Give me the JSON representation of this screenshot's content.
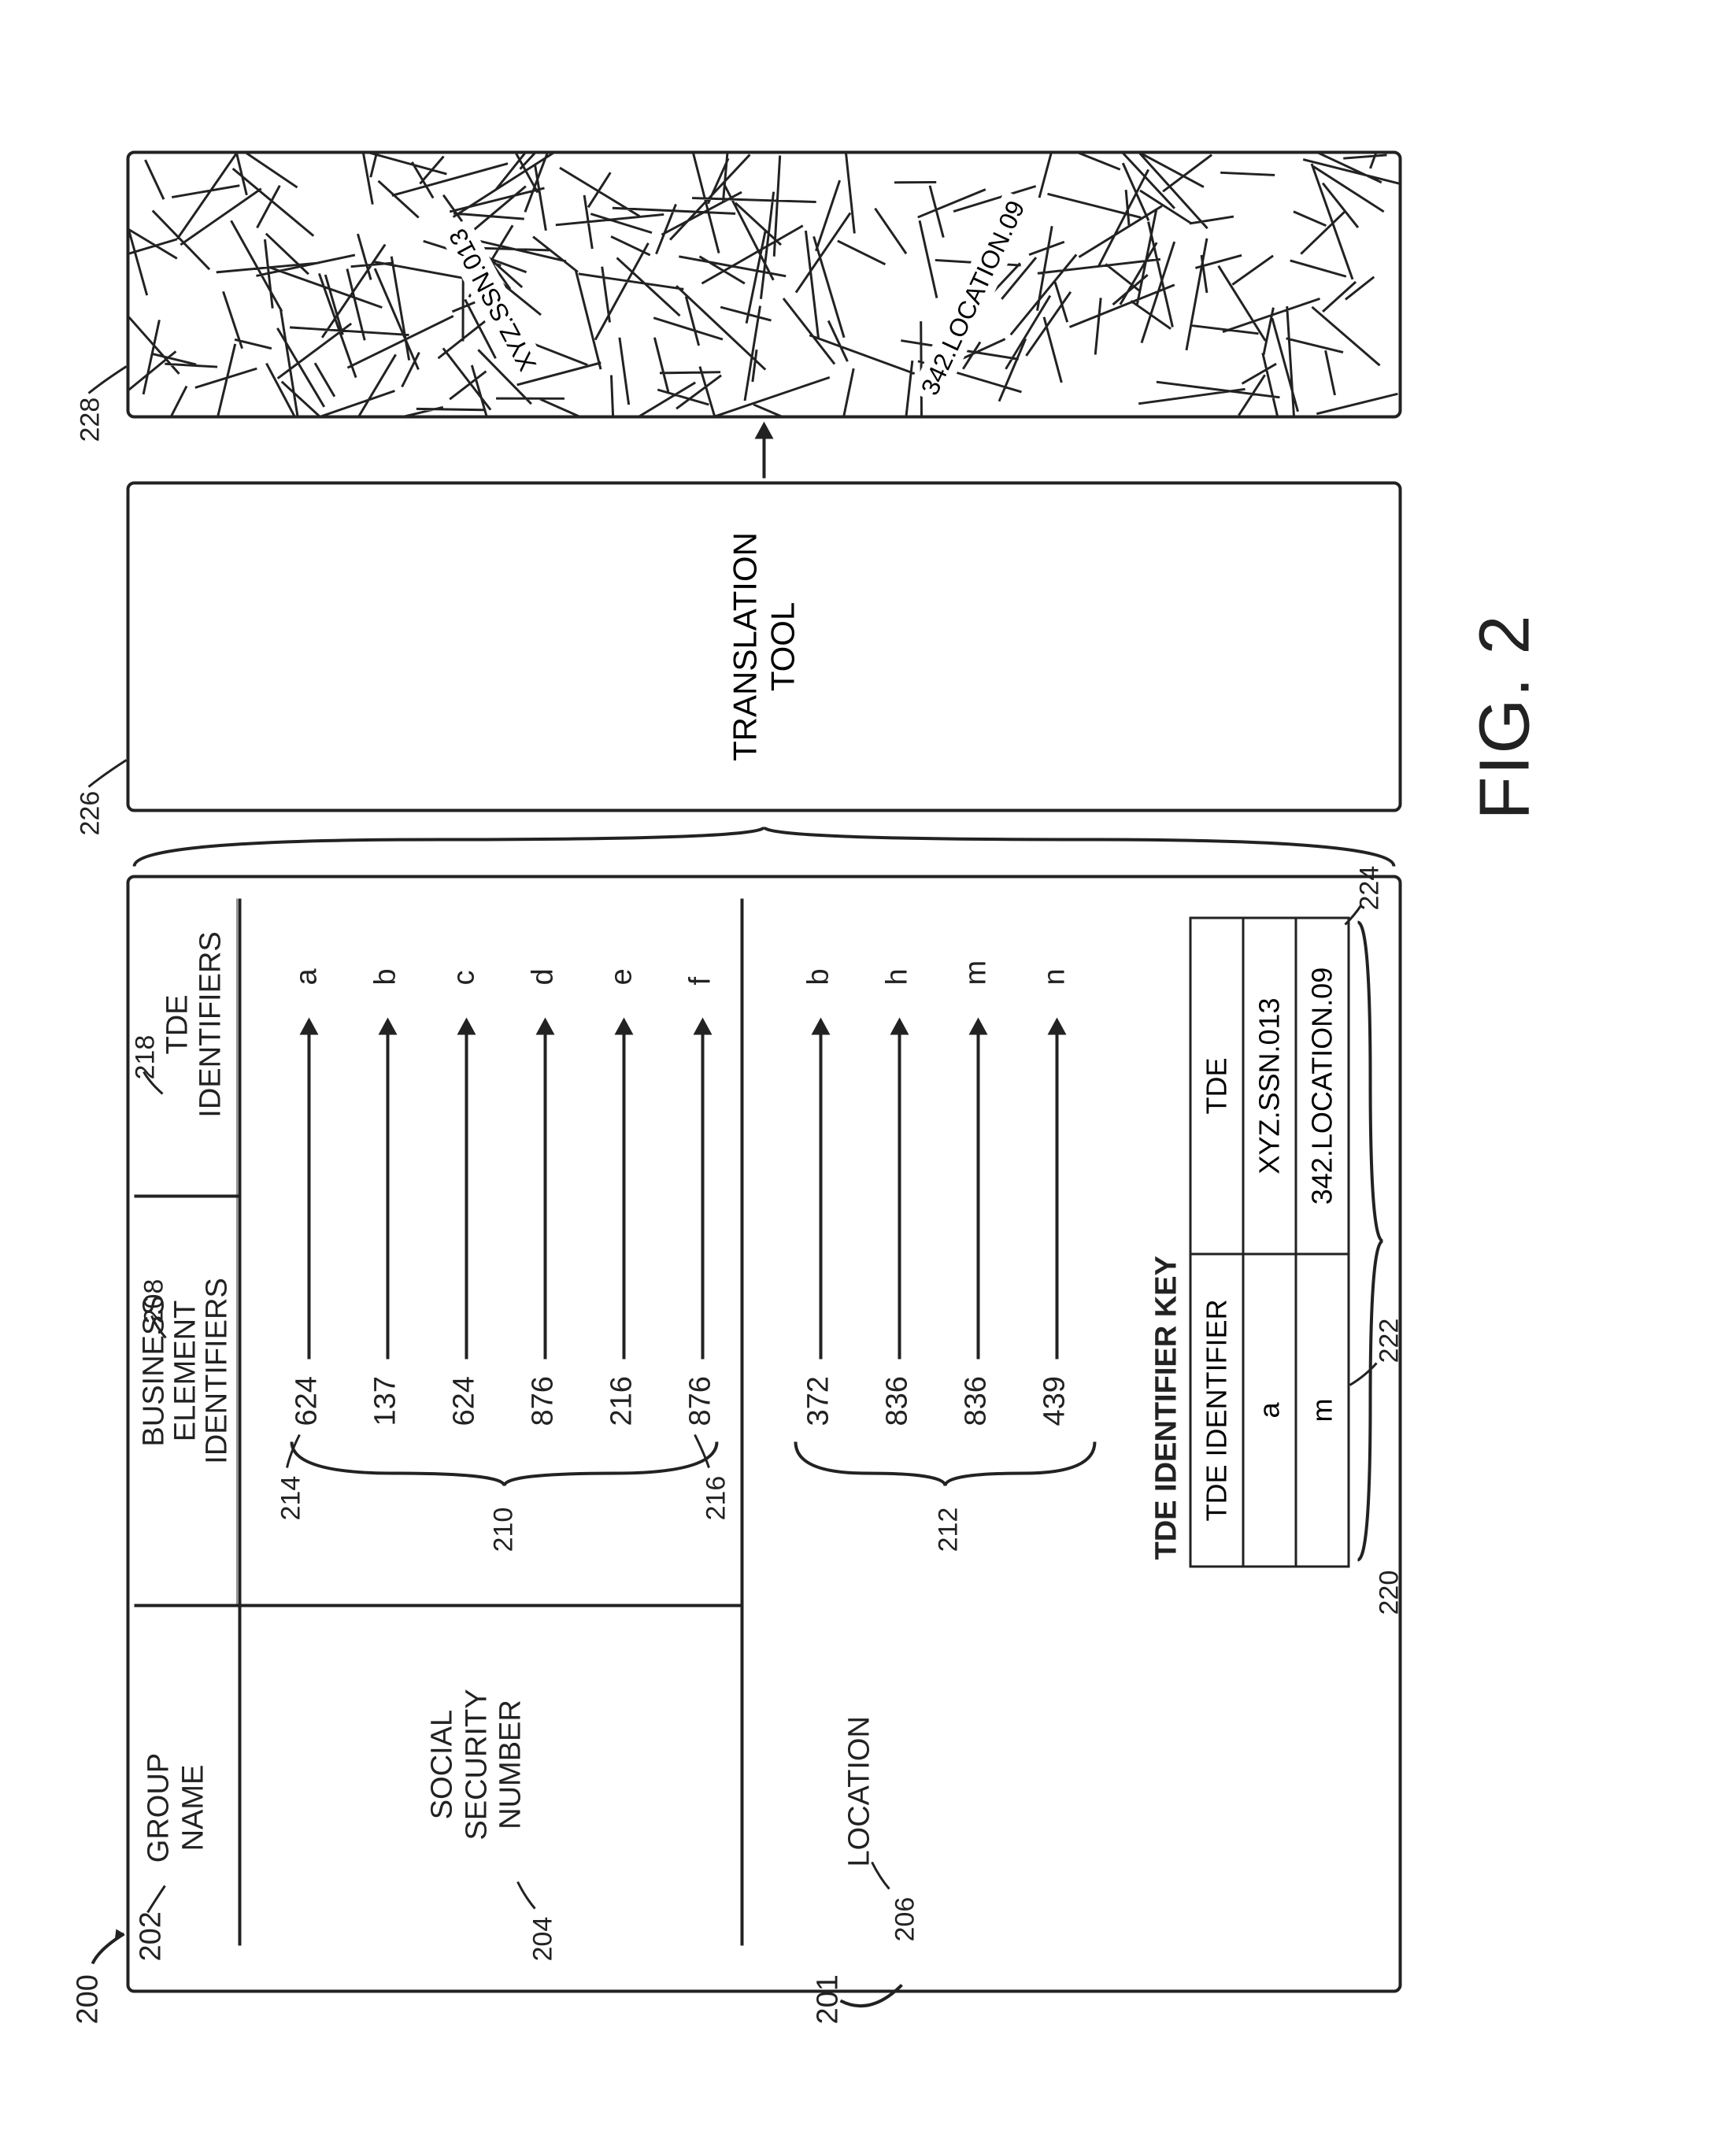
{
  "figure_label": "FIG. 2",
  "refs": {
    "r200": "200",
    "r201": "201",
    "r202": "202",
    "r204": "204",
    "r206": "206",
    "r208": "208",
    "r210": "210",
    "r212": "212",
    "r214": "214",
    "r216": "216",
    "r218": "218",
    "r220": "220",
    "r222": "222",
    "r224": "224",
    "r226": "226",
    "r228": "228"
  },
  "headers": {
    "group": "GROUP\nNAME",
    "business": "BUSINESS\nELEMENT\nIDENTIFIERS",
    "tde": "TDE\nIDENTIFIERS"
  },
  "groups": {
    "ssn": {
      "name": "SOCIAL\nSECURITY\nNUMBER",
      "rows": [
        {
          "be": "624",
          "tde": "a"
        },
        {
          "be": "137",
          "tde": "b"
        },
        {
          "be": "624",
          "tde": "c"
        },
        {
          "be": "876",
          "tde": "d"
        },
        {
          "be": "216",
          "tde": "e"
        },
        {
          "be": "876",
          "tde": "f"
        }
      ]
    },
    "location": {
      "name": "LOCATION",
      "rows": [
        {
          "be": "372",
          "tde": "b"
        },
        {
          "be": "836",
          "tde": "h"
        },
        {
          "be": "836",
          "tde": "m"
        },
        {
          "be": "439",
          "tde": "n"
        }
      ]
    }
  },
  "key": {
    "title": "TDE IDENTIFIER KEY",
    "h1": "TDE IDENTIFIER",
    "h2": "TDE",
    "rows": [
      {
        "id": "a",
        "tde": "XYZ.SSN.013"
      },
      {
        "id": "m",
        "tde": "342.LOCATION.09"
      }
    ]
  },
  "translation": "TRANSLATION\nTOOL",
  "hatch_texts": {
    "t1": "XYZ.SSN.013",
    "t2": "342.LOCATION.09"
  }
}
